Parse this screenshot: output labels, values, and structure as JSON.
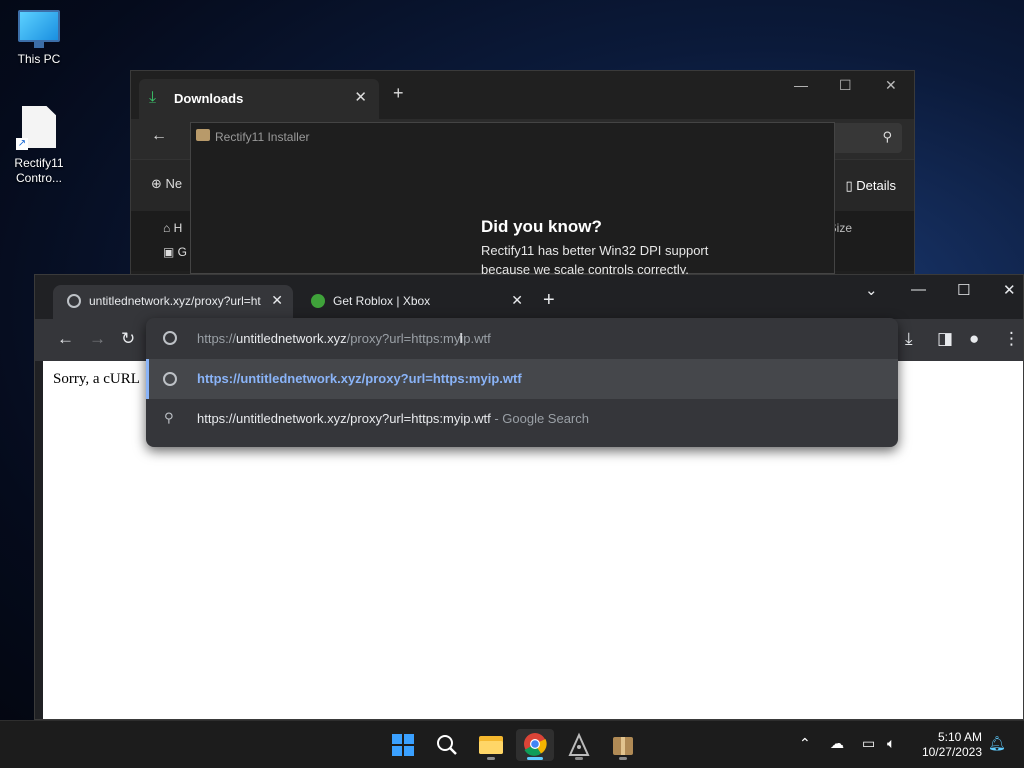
{
  "desktop": {
    "icons": [
      {
        "label": "This PC",
        "icon": "monitor-icon"
      },
      {
        "label": "Rectify11 Contro...",
        "icon": "document-shortcut-icon"
      }
    ]
  },
  "explorer": {
    "tab_label": "Downloads",
    "tab_icon": "download-icon",
    "new_label": "Ne",
    "details_label": "Details",
    "size_header": "Size",
    "sidebar": [
      "H",
      "G"
    ]
  },
  "installer": {
    "title": "Rectify11 Installer",
    "heading": "Did you know?",
    "body": "Rectify11 has better Win32 DPI support because we scale controls correctly."
  },
  "chrome": {
    "tabs": [
      {
        "label": "untitlednetwork.xyz/proxy?url=ht",
        "favicon": "globe-icon",
        "active": true
      },
      {
        "label": "Get Roblox | Xbox",
        "favicon": "xbox-icon",
        "active": false
      }
    ],
    "page_text": "Sorry, a cURL",
    "omnibox": {
      "prefix": "https://",
      "host": "untitlednetwork.xyz",
      "path": "/proxy?url=https:myip.wtf",
      "suggestions": [
        {
          "text": "https://untitlednetwork.xyz/proxy?url=https:myip.wtf",
          "suffix": "",
          "icon": "globe-icon",
          "selected": true
        },
        {
          "text": "https://untitlednetwork.xyz/proxy?url=https:myip.wtf",
          "suffix": " - Google Search",
          "icon": "search-icon",
          "selected": false
        }
      ]
    }
  },
  "taskbar": {
    "apps": [
      "start-icon",
      "search-icon",
      "file-explorer-icon",
      "chrome-icon",
      "pen-tool-icon",
      "package-icon"
    ],
    "active_app": "chrome-icon",
    "time": "5:10 AM",
    "date": "10/27/2023"
  },
  "colors": {
    "accent": "#8ab4f8",
    "taskbar_active": "#60cdff",
    "download_green": "#3bc46b"
  }
}
